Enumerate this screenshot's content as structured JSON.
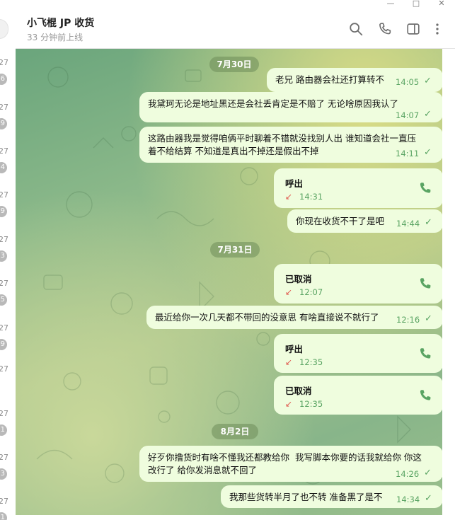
{
  "left_strip": [
    {
      "time": "27",
      "badge": "6"
    },
    {
      "time": "27",
      "badge": "9"
    },
    {
      "time": "27",
      "badge": "4"
    },
    {
      "time": "27",
      "badge": "9"
    },
    {
      "time": "27",
      "badge": "3"
    },
    {
      "time": "27",
      "badge": "5"
    },
    {
      "time": "27",
      "badge": "9"
    },
    {
      "time": "27",
      "badge": ""
    },
    {
      "time": "27",
      "badge": "1"
    },
    {
      "time": "27",
      "badge": "3"
    },
    {
      "time": "27",
      "badge": "1"
    }
  ],
  "header": {
    "title": "小飞棍 JP 收货",
    "status": "33 分钟前上线",
    "icons": [
      "search-icon",
      "phone-icon",
      "sidebar-toggle-icon",
      "more-vertical-icon"
    ]
  },
  "window_controls": [
    "minimize",
    "maximize",
    "close"
  ],
  "colors": {
    "bubble": "#effdde",
    "time": "#5aa463",
    "missed": "#e05a4f",
    "accent": "#5aa463"
  },
  "messages": [
    {
      "type": "date",
      "text": "7月30日"
    },
    {
      "type": "text",
      "lines": [
        "老兄 路由器会社还打算转不"
      ],
      "time": "14:05"
    },
    {
      "type": "text",
      "lines": [
        "我黛珂无论是地址黑还是会社丢肯定是不赔了 无论啥原因我认了"
      ],
      "time": "14:07"
    },
    {
      "type": "text",
      "lines": [
        "这路由器我是觉得咱俩平时聊着不错就没找别人出 谁知道会社一直压",
        "着不给结算 不知道是真出不掉还是假出不掉"
      ],
      "time": "14:11"
    },
    {
      "type": "call",
      "label": "呼出",
      "time": "14:31"
    },
    {
      "type": "text",
      "lines": [
        "你现在收货不干了是吧"
      ],
      "time": "14:44"
    },
    {
      "type": "date",
      "text": "7月31日"
    },
    {
      "type": "call",
      "label": "已取消",
      "time": "12:07"
    },
    {
      "type": "text",
      "lines": [
        "最近给你一次几天都不带回的没意思 有啥直接说不就行了"
      ],
      "time": "12:16"
    },
    {
      "type": "call",
      "label": "呼出",
      "time": "12:35"
    },
    {
      "type": "call",
      "label": "已取消",
      "time": "12:35"
    },
    {
      "type": "date",
      "text": "8月2日"
    },
    {
      "type": "text",
      "lines": [
        "好歹你撸货时有啥不懂我还都教给你  我写脚本你要的话我就给你 你这",
        "改行了 给你发消息就不回了"
      ],
      "time": "14:26"
    },
    {
      "type": "text",
      "lines": [
        "我那些货转半月了也不转 准备黑了是不"
      ],
      "time": "14:34"
    }
  ]
}
